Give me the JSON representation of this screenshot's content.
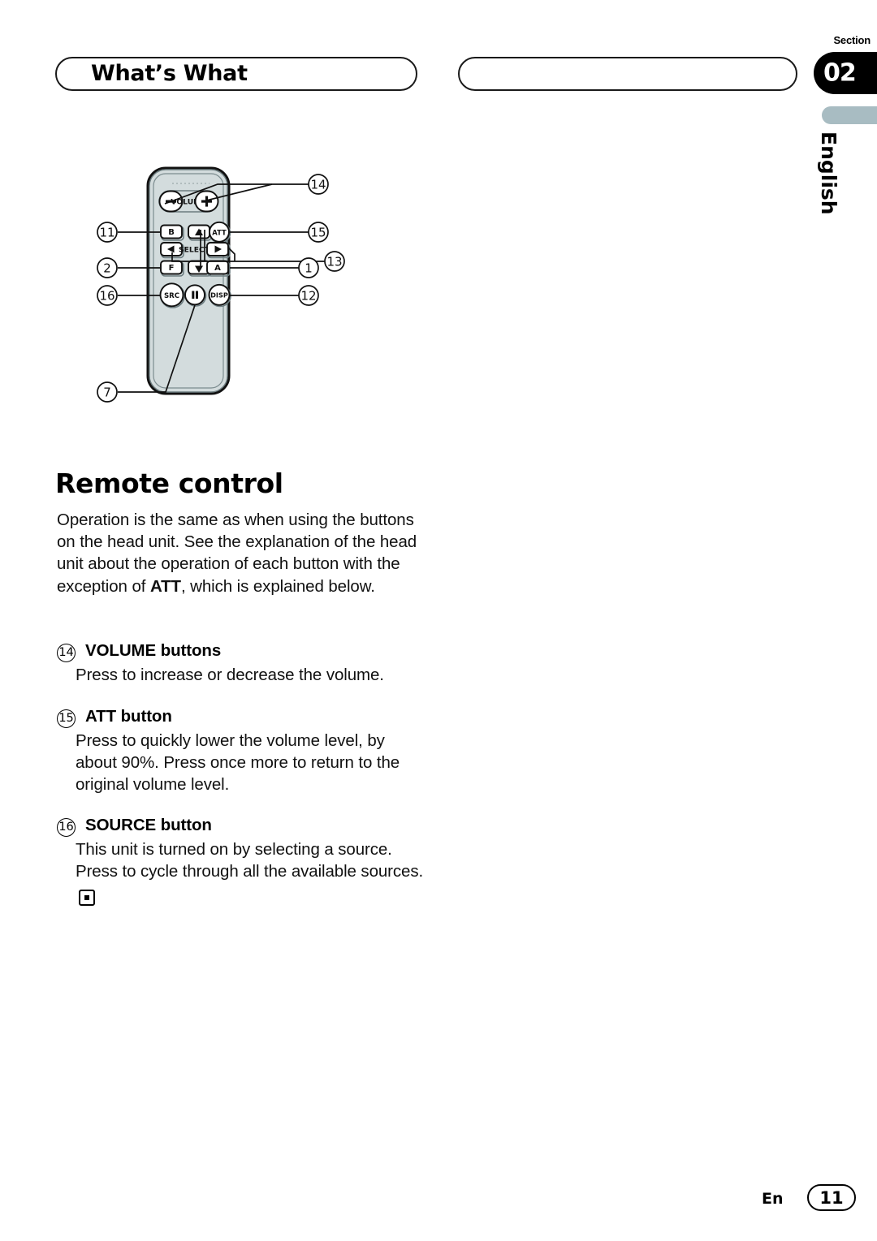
{
  "header": {
    "title": "What’s What",
    "secondary_title": "",
    "section_label": "Section",
    "section_number": "02",
    "language_tab": "English"
  },
  "figure": {
    "name": "remote-control-diagram",
    "remote_body_color": "#d3dcdd",
    "button_labels": {
      "volume": "VOLUME",
      "volume_minus": "−",
      "volume_plus": "+",
      "b": "B",
      "att": "ATT",
      "up": "▲",
      "left": "◀",
      "select": "SELECT",
      "right": "▶",
      "f": "F",
      "down": "▼",
      "a": "A",
      "src": "SRC",
      "pause": "❙❙",
      "disp": "DISP"
    },
    "callouts": [
      {
        "id": "14",
        "side": "right",
        "target": "volume-buttons"
      },
      {
        "id": "11",
        "side": "left",
        "target": "b-button"
      },
      {
        "id": "15",
        "side": "right",
        "target": "att-button"
      },
      {
        "id": "13",
        "side": "right",
        "target": "select-arrows"
      },
      {
        "id": "2",
        "side": "left",
        "target": "f-button"
      },
      {
        "id": "1",
        "side": "right",
        "target": "a-button"
      },
      {
        "id": "16",
        "side": "left",
        "target": "src-button"
      },
      {
        "id": "12",
        "side": "right",
        "target": "disp-button"
      },
      {
        "id": "7",
        "side": "left",
        "target": "pause-button"
      }
    ]
  },
  "main": {
    "heading": "Remote control",
    "intro_before": "Operation is the same as when using the buttons on the head unit. See the explanation of the head unit about the operation of each button with the exception of ",
    "intro_bold": "ATT",
    "intro_after": ", which is explained below.",
    "items": [
      {
        "number": "14",
        "title": "VOLUME buttons",
        "body": "Press to increase or decrease the volume.",
        "end_mark": false
      },
      {
        "number": "15",
        "title": "ATT button",
        "body": "Press to quickly lower the volume level, by about 90%. Press once more to return to the original volume level.",
        "end_mark": false
      },
      {
        "number": "16",
        "title": "SOURCE button",
        "body": "This unit is turned on by selecting a source. Press to cycle through all the available sources.",
        "end_mark": true
      }
    ]
  },
  "footer": {
    "language_code": "En",
    "page_number": "11"
  }
}
